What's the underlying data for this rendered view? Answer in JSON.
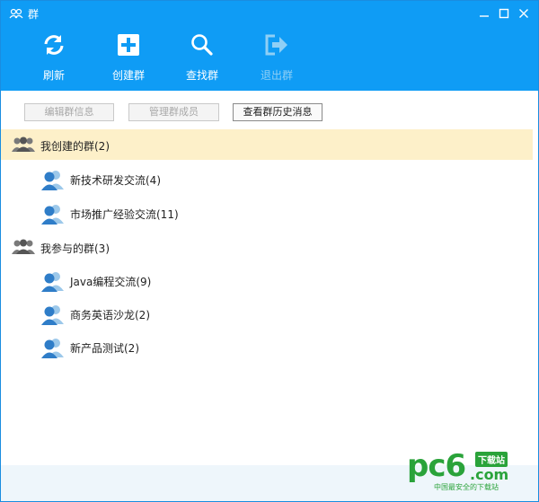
{
  "window": {
    "title": "群"
  },
  "toolbar": {
    "refresh": "刷新",
    "create": "创建群",
    "find": "查找群",
    "quit": "退出群"
  },
  "actions": {
    "edit_info": "编辑群信息",
    "manage_members": "管理群成员",
    "history": "查看群历史消息"
  },
  "sections": {
    "created": {
      "title": "我创建的群(2)",
      "items": [
        {
          "label": "新技术研发交流(4)"
        },
        {
          "label": "市场推广经验交流(11)"
        }
      ]
    },
    "joined": {
      "title": "我参与的群(3)",
      "items": [
        {
          "label": "Java编程交流(9)"
        },
        {
          "label": "商务英语沙龙(2)"
        },
        {
          "label": "新产品测试(2)"
        }
      ]
    }
  },
  "watermark": {
    "brand": "pc6",
    "badge": "下载站",
    "domain": ".com",
    "tagline": "中国最安全的下载站"
  },
  "colors": {
    "toolbar_bg": "#0f9cf5",
    "selected_row": "#fdf0c9",
    "footer": "#eef6fb",
    "logo_green": "#2aa33a"
  }
}
